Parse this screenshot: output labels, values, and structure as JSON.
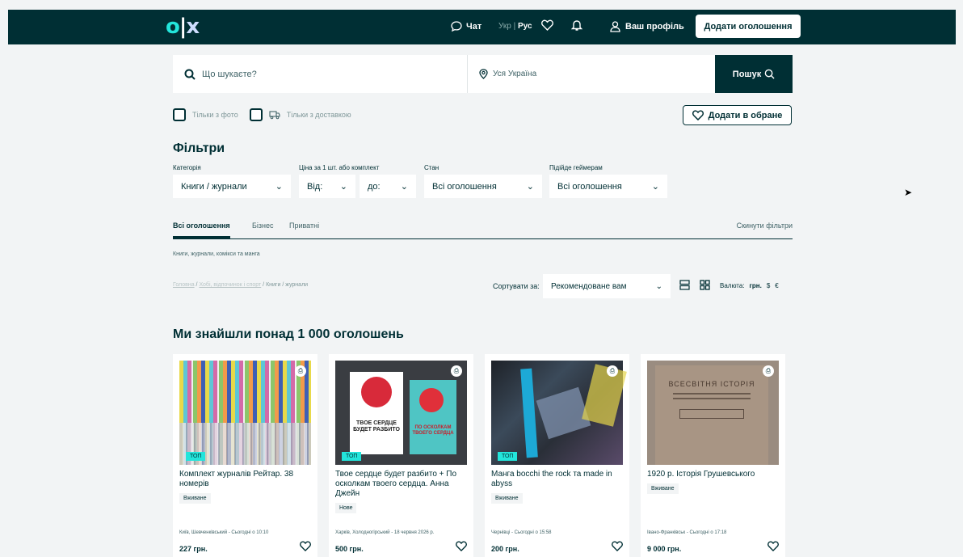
{
  "header": {
    "logo": "o|x",
    "chat_label": "Чат",
    "lang_ukr": "Укр",
    "lang_sep": "|",
    "lang_rus": "Рус",
    "profile_label": "Ваш профіль",
    "add_button": "Додати оголошення"
  },
  "search": {
    "placeholder": "Що шукаєте?",
    "location": "Уся Україна",
    "button": "Пошук"
  },
  "checkboxes": {
    "photo_only": "Тільки з фото",
    "delivery_only": "Тільки з доставкою"
  },
  "favorite_button": "Додати в обране",
  "filters": {
    "title": "Фільтри",
    "category_label": "Категорія",
    "category_value": "Книги / журнали",
    "price_label": "Ціна за 1 шт. або комплект",
    "price_from": "Від:",
    "price_to": "до:",
    "condition_label": "Стан",
    "condition_value": "Всі оголошення",
    "gamers_label": "Підійде геймерам",
    "gamers_value": "Всі оголошення"
  },
  "tabs": {
    "all": "Всі оголошення",
    "business": "Бізнес",
    "private": "Приватні",
    "reset": "Скинути фільтри"
  },
  "category_line": "Книги, журнали, комікси та манга",
  "breadcrumbs": {
    "home": "Головна",
    "hobby": "Хобі, відпочинок і спорт",
    "sep": " / ",
    "current": "Книги / журнали"
  },
  "sort": {
    "label": "Сортувати за:",
    "value": "Рекомендоване вам"
  },
  "currency": {
    "label": "Валюта:",
    "uah": "грн.",
    "usd": "$",
    "eur": "€"
  },
  "results_title": "Ми знайшли понад 1 000 оголошень",
  "cards": [
    {
      "title": "Комплект журналів Рейтар. 38 номерів",
      "condition": "Вживане",
      "location": "Київ, Шевченківський - Сьогодні о 10:10",
      "price": "227 грн.",
      "top": "ТОП",
      "delivery": true
    },
    {
      "title": "Твое сердце будет разбито + По осколкам твоего сердца. Анна Джейн",
      "condition": "Нове",
      "location": "Харків, Холодногірський - 18 червня 2026 р.",
      "price": "500 грн.",
      "top": "ТОП",
      "delivery": true,
      "image_text": "ТВОЕ СЕРДЦЕ БУДЕТ РАЗБИТО",
      "image_text2": "ПО ОСКОЛКАМ ТВОЕГО СЕРДЦА"
    },
    {
      "title": "Манга bocchi the rock та made in abyss",
      "condition": "Вживане",
      "location": "Чернівці - Сьогодні о 15:58",
      "price": "200 грн.",
      "top": "ТОП",
      "delivery": true
    },
    {
      "title": "1920 р. Історія Грушевського",
      "condition": "Вживане",
      "location": "Івано-Франківськ - Сьогодні о 17:18",
      "price": "9 000 грн.",
      "delivery": true,
      "image_text": "ВСЕСВІТНЯ ІСТОРІЯ"
    }
  ],
  "colors": {
    "brand_dark": "#002f34",
    "accent_teal": "#23e5db"
  }
}
